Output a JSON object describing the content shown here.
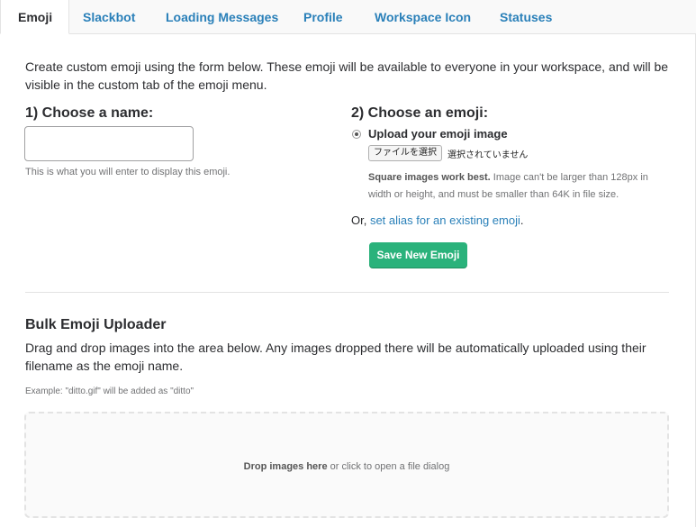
{
  "tabs": [
    {
      "label": "Emoji",
      "active": true
    },
    {
      "label": "Slackbot"
    },
    {
      "label": "Loading Messages"
    },
    {
      "label": "Profile"
    },
    {
      "label": "Workspace Icon"
    },
    {
      "label": "Statuses"
    }
  ],
  "intro": "Create custom emoji using the form below. These emoji will be available to everyone in your workspace, and will be visible in the custom tab of the emoji menu.",
  "step1": {
    "title": "1) Choose a name:",
    "input_value": "",
    "hint": "This is what you will enter to display this emoji."
  },
  "step2": {
    "title": "2) Choose an emoji:",
    "upload_label": "Upload your emoji image",
    "file_button": "ファイルを選択",
    "file_status": "選択されていません",
    "note_bold": "Square images work best.",
    "note_rest": " Image can't be larger than 128px in width or height, and must be smaller than 64K in file size.",
    "alias_prefix": "Or, ",
    "alias_link": "set alias for an existing emoji",
    "alias_suffix": ".",
    "save_button": "Save New Emoji"
  },
  "bulk": {
    "title": "Bulk Emoji Uploader",
    "description": "Drag and drop images into the area below. Any images dropped there will be automatically uploaded using their filename as the emoji name.",
    "example": "Example: \"ditto.gif\" will be added as \"ditto\"",
    "drop_bold": "Drop images here",
    "drop_rest": " or click to open a file dialog"
  },
  "colors": {
    "link": "#2a80b9",
    "button": "#2ab27b"
  }
}
